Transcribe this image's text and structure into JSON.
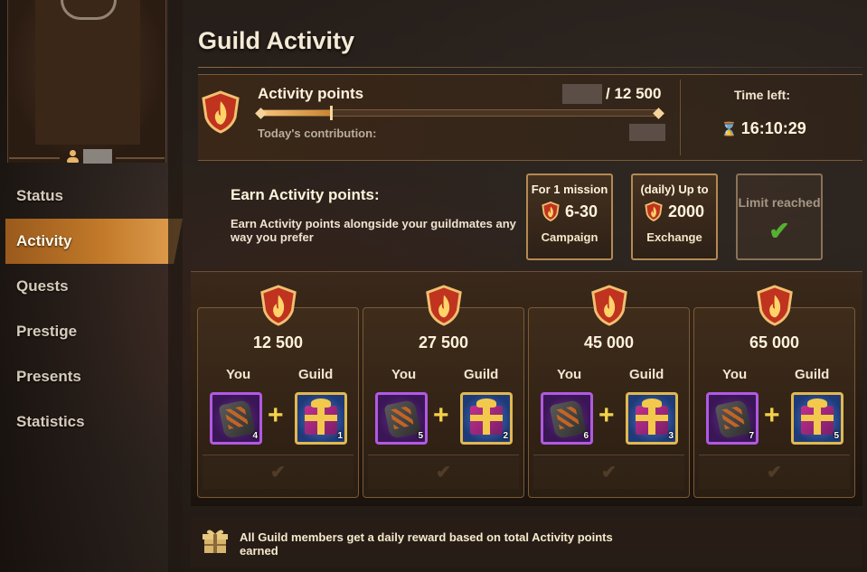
{
  "colors": {
    "accent": "#c27a2a",
    "shield": "#c0331e",
    "check": "#55b034",
    "you_frame": "#b05ae0",
    "guild_frame": "#e0b850"
  },
  "sidebar": {
    "items": [
      {
        "label": "Status",
        "active": false
      },
      {
        "label": "Activity",
        "active": true
      },
      {
        "label": "Quests",
        "active": false
      },
      {
        "label": "Prestige",
        "active": false
      },
      {
        "label": "Presents",
        "active": false
      },
      {
        "label": "Statistics",
        "active": false
      }
    ]
  },
  "header": {
    "title": "Guild Activity"
  },
  "points": {
    "label": "Activity points",
    "total": "/ 12 500",
    "contribution_label": "Today's contribution:",
    "progress": 0.18,
    "time_label": "Time left:",
    "time_value": "16:10:29"
  },
  "earn": {
    "title": "Earn Activity points:",
    "description": "Earn Activity points alongside your guildmates any way you prefer",
    "cards": [
      {
        "top": "For 1 mission",
        "value": "6-30",
        "bottom": "Campaign"
      },
      {
        "top": "(daily) Up to",
        "value": "2000",
        "bottom": "Exchange"
      }
    ],
    "limit_label": "Limit reached"
  },
  "tiers": [
    {
      "value": "12 500",
      "you_label": "You",
      "guild_label": "Guild",
      "you_count": "4",
      "guild_count": "1"
    },
    {
      "value": "27 500",
      "you_label": "You",
      "guild_label": "Guild",
      "you_count": "5",
      "guild_count": "2"
    },
    {
      "value": "45 000",
      "you_label": "You",
      "guild_label": "Guild",
      "you_count": "6",
      "guild_count": "3"
    },
    {
      "value": "65 000",
      "you_label": "You",
      "guild_label": "Guild",
      "you_count": "7",
      "guild_count": "5"
    }
  ],
  "icons": {
    "shield": "activity-shield-icon",
    "gift": "gift-icon",
    "hourglass": "hourglass-icon",
    "plus": "plus-icon",
    "check": "checkmark-icon"
  },
  "footer": {
    "text": "All Guild members get a daily reward based on total Activity points earned"
  }
}
